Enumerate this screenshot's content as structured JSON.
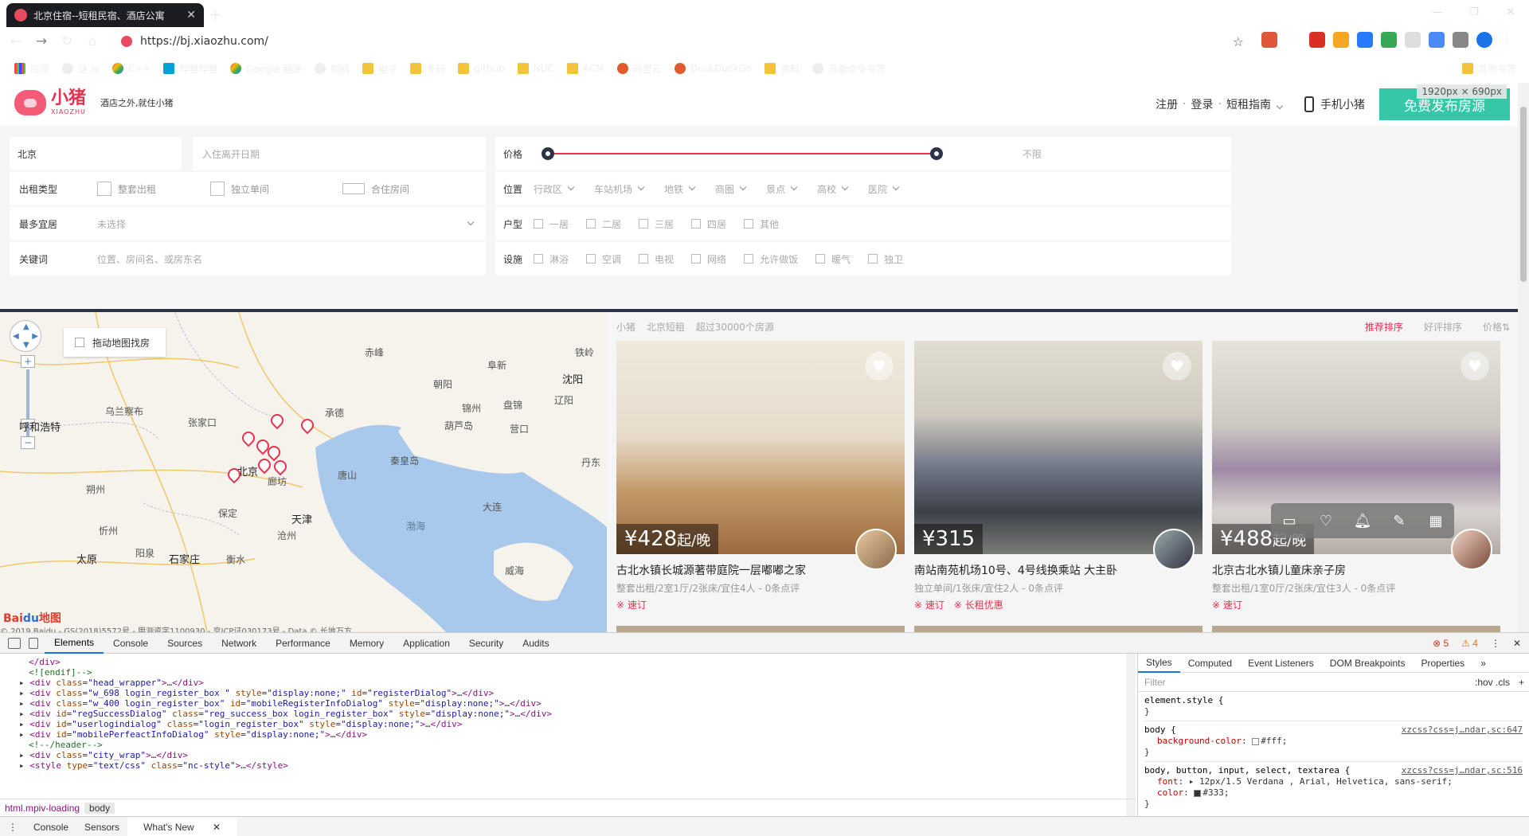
{
  "browser": {
    "tab_title": "北京住宿--短租民宿、酒店公寓",
    "url": "https://bj.xiaozhu.com/",
    "bookmarks": [
      "应用",
      "谜.io",
      "C++",
      "哔哩哔哩",
      "Google 翻译",
      "知网",
      "电子",
      "考研",
      "github",
      "NUC",
      "ACM",
      "阿里云",
      "DuckDuckGo",
      "资料",
      "万能命令书签"
    ],
    "other_bookmarks": "其他书签",
    "viewport_badge": "1920px × 690px"
  },
  "header": {
    "logo_cn": "小猪",
    "logo_en": "XIAOZHU",
    "slogan": "酒店之外,就住小猪",
    "nav": [
      "注册",
      "登录",
      "短租指南"
    ],
    "mobile": "手机小猪",
    "publish": "免费发布房源"
  },
  "filters": {
    "city": "北京",
    "date_placeholder": "入住离开日期",
    "price_label": "价格",
    "price_unlimited": "不限",
    "rent_type_label": "出租类型",
    "rent_types": [
      "整套出租",
      "独立单间",
      "合住房间"
    ],
    "location_label": "位置",
    "locations": [
      "行政区",
      "车站机场",
      "地铁",
      "商圈",
      "景点",
      "高校",
      "医院"
    ],
    "guests_label": "最多宜居",
    "guests_value": "未选择",
    "layout_label": "户型",
    "layouts": [
      "一居",
      "二居",
      "三居",
      "四居",
      "其他"
    ],
    "keyword_label": "关键词",
    "keyword_placeholder": "位置、房间名、或房东名",
    "amenities_label": "设施",
    "amenities": [
      "淋浴",
      "空调",
      "电视",
      "网络",
      "允许做饭",
      "暖气",
      "独卫"
    ]
  },
  "map": {
    "drag_search": "拖动地图找房",
    "labels": [
      "赤峰",
      "阜新",
      "铁岭",
      "沈阳",
      "乌兰察布",
      "张家口",
      "承德",
      "锦州",
      "盘锦",
      "辽阳",
      "朝阳",
      "葫芦岛",
      "营口",
      "呼和浩特",
      "北京",
      "廊坊",
      "秦皇岛",
      "唐山",
      "丹东",
      "朔州",
      "保定",
      "天津",
      "大连",
      "渤海",
      "忻州",
      "沧州",
      "太原",
      "阳泉",
      "石家庄",
      "衡水",
      "威海"
    ],
    "copyright": "© 2019 Baidu - GS(2018)5572号 - 甲测资字1100930 - 京ICP证030173号 - Data © 长地万方"
  },
  "listings": {
    "breadcrumb": [
      "小猪",
      "北京短租",
      "超过30000个房源"
    ],
    "sorts": [
      "推荐排序",
      "好评排序",
      "价格⇅"
    ],
    "cards": [
      {
        "price": "¥428",
        "unit": "起/晚",
        "title": "古北水镇长城源著带庭院一层嘟嘟之家",
        "meta": "整套出租/2室1厅/2张床/宜住4人 - 0条点评",
        "tags": [
          "※ 速订"
        ]
      },
      {
        "price": "¥315",
        "unit": "",
        "title": "南站南苑机场10号、4号线换乘站 大主卧",
        "meta": "独立单间/1张床/宜住2人 - 0条点评",
        "tags": [
          "※ 速订",
          "※ 长租优惠"
        ]
      },
      {
        "price": "¥488",
        "unit": "起/晚",
        "title": "北京古北水镇儿童床亲子房",
        "meta": "整套出租/1室0厅/2张床/宜住3人 - 0条点评",
        "tags": [
          "※ 速订"
        ]
      }
    ]
  },
  "devtools": {
    "tabs": [
      "Elements",
      "Console",
      "Sources",
      "Network",
      "Performance",
      "Memory",
      "Application",
      "Security",
      "Audits"
    ],
    "errors": "5",
    "warnings": "4",
    "breadcrumb": [
      "html.mpiv-loading",
      "body"
    ],
    "style_tabs": [
      "Styles",
      "Computed",
      "Event Listeners",
      "DOM Breakpoints",
      "Properties"
    ],
    "filter_placeholder": "Filter",
    "filter_buttons": ":hov  .cls",
    "drawer_tabs": [
      "Console",
      "Sensors",
      "What's New"
    ],
    "rule_src": "xzcss?css=j…ndar,sc:647",
    "rule_src2": "xzcss?css=j…ndar,sc:516"
  }
}
